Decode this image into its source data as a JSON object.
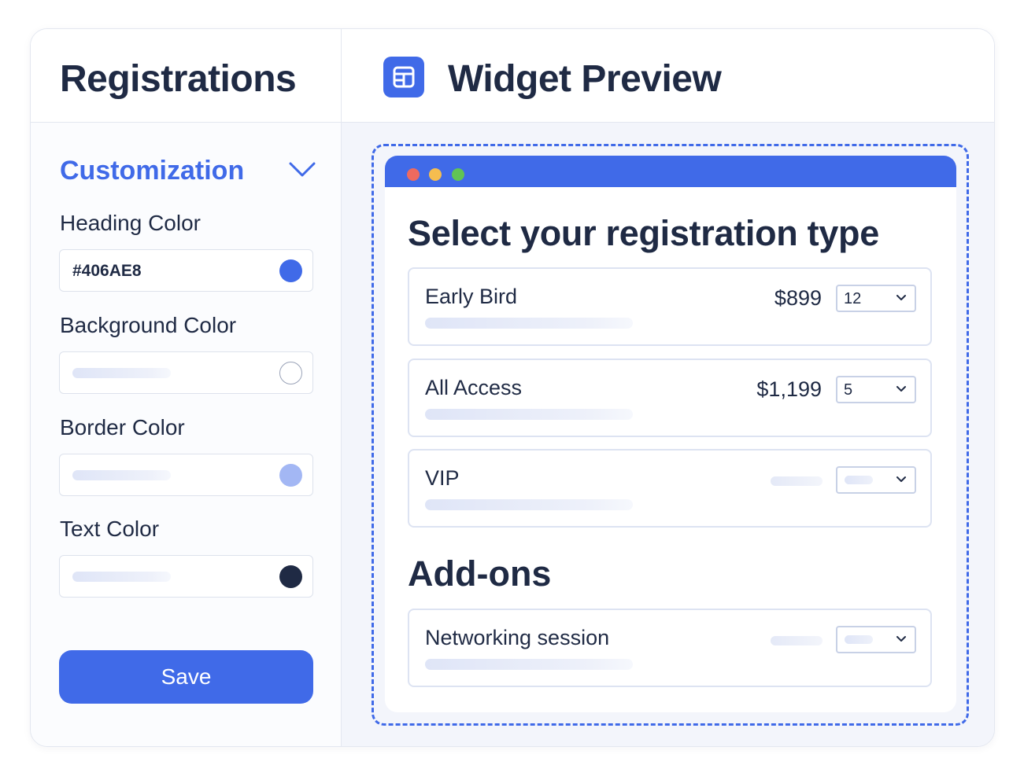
{
  "left_header": {
    "title": "Registrations"
  },
  "right_header": {
    "icon": "layout-icon",
    "title": "Widget Preview"
  },
  "customization": {
    "title": "Customization",
    "fields": [
      {
        "label": "Heading Color",
        "value": "#406AE8",
        "swatch": "#406AE8"
      },
      {
        "label": "Background Color",
        "value": "",
        "swatch": "#FFFFFF"
      },
      {
        "label": "Border Color",
        "value": "",
        "swatch": "#A3B7F4"
      },
      {
        "label": "Text Color",
        "value": "",
        "swatch": "#1F2A44"
      }
    ],
    "save_label": "Save"
  },
  "preview": {
    "window_dots": [
      "#EE6A5F",
      "#F5BD4F",
      "#61C454"
    ],
    "heading": "Select your registration type",
    "options": [
      {
        "name": "Early Bird",
        "price": "$899",
        "quantity": "12"
      },
      {
        "name": "All Access",
        "price": "$1,199",
        "quantity": "5"
      },
      {
        "name": "VIP",
        "price": "",
        "quantity": ""
      }
    ],
    "addons_heading": "Add-ons",
    "addons": [
      {
        "name": "Networking session",
        "price": "",
        "quantity": ""
      }
    ]
  },
  "colors": {
    "accent": "#406AE8",
    "text": "#1F2A44",
    "border": "#DDE3F2"
  }
}
